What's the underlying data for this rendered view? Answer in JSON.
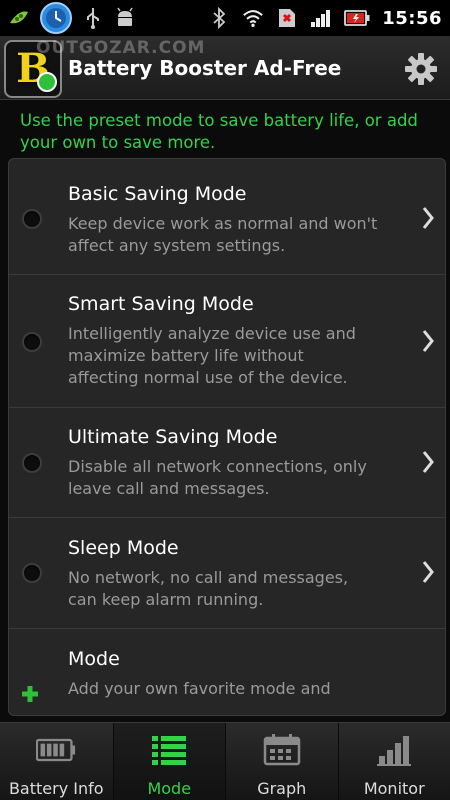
{
  "status_bar": {
    "time": "15:56",
    "icons": [
      "usb-icon",
      "android-debug-icon",
      "bluetooth-icon",
      "wifi-icon",
      "no-sim-icon",
      "signal-icon",
      "battery-icon"
    ]
  },
  "header": {
    "logo_letter": "B",
    "watermark": "OUTGOZAR.COM",
    "title": "Battery Booster Ad-Free",
    "settings_icon": "gear-icon"
  },
  "intro_text": "Use the preset mode to save battery life, or add your own to save more.",
  "modes": [
    {
      "title": "Basic Saving Mode",
      "description": "Keep device work as normal and won't affect any system settings."
    },
    {
      "title": "Smart Saving Mode",
      "description": "Intelligently analyze device use and maximize battery life without affecting normal use of the device."
    },
    {
      "title": "Ultimate Saving Mode",
      "description": "Disable all network connections, only leave call and messages."
    },
    {
      "title": "Sleep Mode",
      "description": "No network, no call and messages, can keep alarm running."
    },
    {
      "title": "Mode",
      "description": "Add your own favorite mode and"
    }
  ],
  "tabs": [
    {
      "label": "Battery Info",
      "icon": "battery-info-icon",
      "active": false
    },
    {
      "label": "Mode",
      "icon": "mode-list-icon",
      "active": true
    },
    {
      "label": "Graph",
      "icon": "graph-calendar-icon",
      "active": false
    },
    {
      "label": "Monitor",
      "icon": "monitor-bars-icon",
      "active": false
    }
  ],
  "colors": {
    "accent_green": "#33d24a",
    "background": "#262626",
    "text_muted": "#9a9a9a"
  }
}
